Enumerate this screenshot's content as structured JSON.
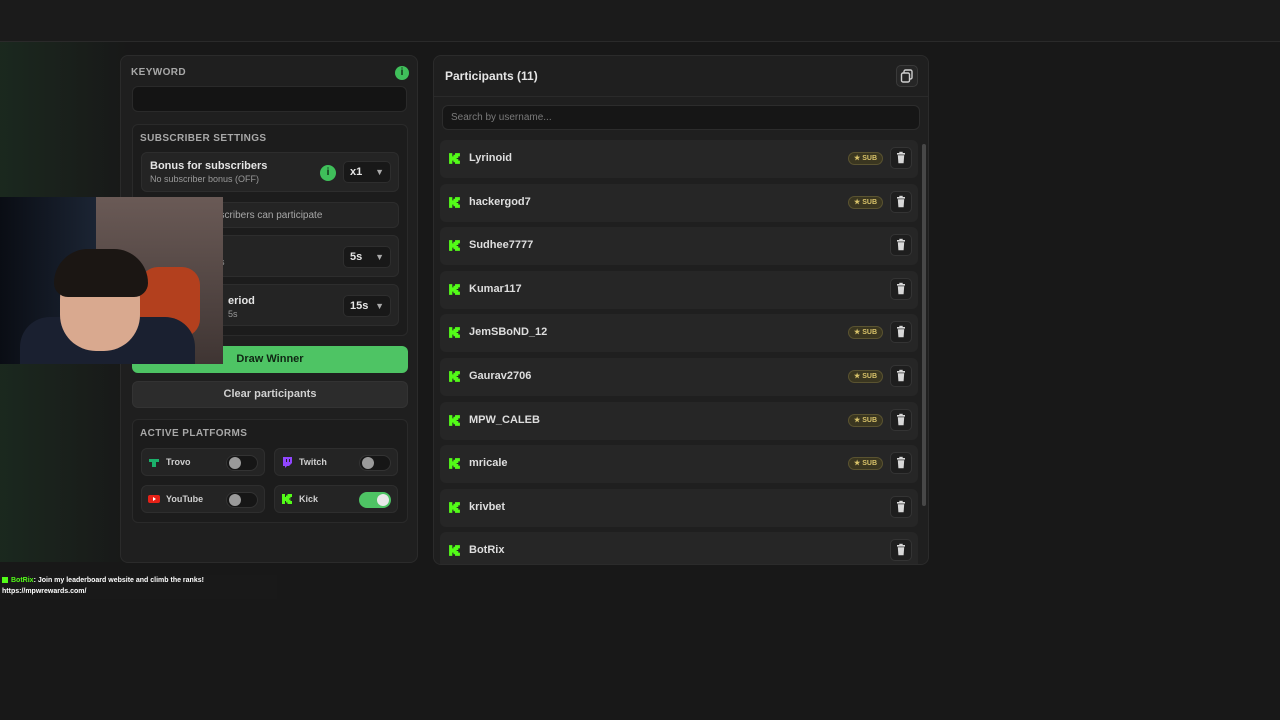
{
  "keyword": {
    "title": "KEYWORD",
    "value": ""
  },
  "subscriber_settings": {
    "title": "SUBSCRIBER SETTINGS",
    "bonus_title": "Bonus for subscribers",
    "bonus_subtitle": "No subscriber bonus (OFF)",
    "bonus_value": "x1",
    "only_subs_text": "bscribers can participate",
    "delay_label": "s",
    "delay_value": "5s",
    "period_label": "eriod",
    "period_sub": "5s",
    "period_value": "15s"
  },
  "buttons": {
    "draw_winner": "Draw Winner",
    "clear": "Clear participants"
  },
  "platforms": {
    "title": "ACTIVE PLATFORMS",
    "items": [
      {
        "name": "Trovo",
        "enabled": false,
        "color": "#1bb06b"
      },
      {
        "name": "Twitch",
        "enabled": false,
        "color": "#9146ff"
      },
      {
        "name": "YouTube",
        "enabled": false,
        "color": "#e62117"
      },
      {
        "name": "Kick",
        "enabled": true,
        "color": "#53fc18"
      }
    ]
  },
  "participants": {
    "title": "Participants (11)",
    "search_placeholder": "Search by username...",
    "sub_label": "SUB",
    "items": [
      {
        "name": "Lyrinoid",
        "sub": true
      },
      {
        "name": "hackergod7",
        "sub": true
      },
      {
        "name": "Sudhee7777",
        "sub": false
      },
      {
        "name": "Kumar117",
        "sub": false
      },
      {
        "name": "JemSBoND_12",
        "sub": true
      },
      {
        "name": "Gaurav2706",
        "sub": true
      },
      {
        "name": "MPW_CALEB",
        "sub": true
      },
      {
        "name": "mricale",
        "sub": true
      },
      {
        "name": "krivbet",
        "sub": false
      },
      {
        "name": "BotRix",
        "sub": false
      }
    ]
  },
  "chat": {
    "user": "BotRix",
    "message": ": Join my leaderboard website and climb the ranks!",
    "link": "https://mpwrewards.com/"
  },
  "colors": {
    "accent": "#4ec464",
    "kick": "#53fc18"
  }
}
